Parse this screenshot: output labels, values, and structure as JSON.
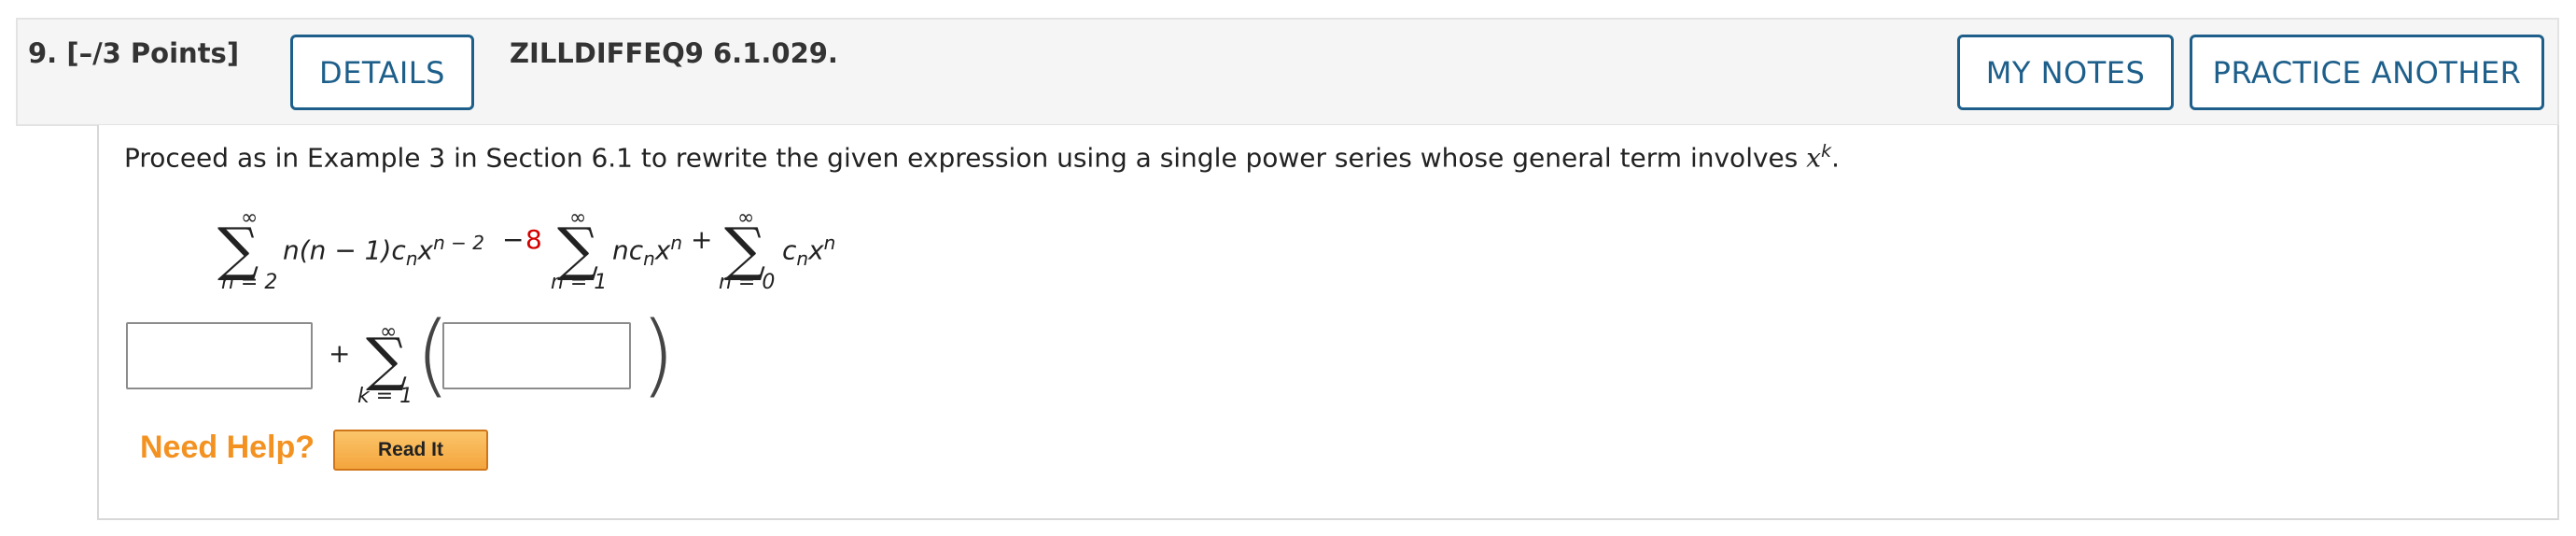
{
  "header": {
    "question_number": "9.",
    "points": "[–/3 Points]",
    "details_button": "DETAILS",
    "problem_code": "ZILLDIFFEQ9 6.1.029.",
    "my_notes_button": "MY NOTES",
    "practice_another_button": "PRACTICE ANOTHER"
  },
  "question": {
    "prompt": "Proceed as in Example 3 in Section 6.1 to rewrite the given expression using a single power series whose general term involves",
    "prompt_var": "x",
    "prompt_sup": "k",
    "prompt_end": ".",
    "expression": {
      "sum1": {
        "upper": "∞",
        "lower": "n = 2",
        "term": "n(n − 1)c",
        "sub": "n",
        "x": "x",
        "exp": "n − 2"
      },
      "op1": "−",
      "coef": "8",
      "sum2": {
        "upper": "∞",
        "lower": "n = 1",
        "term": "nc",
        "sub": "n",
        "x": "x",
        "exp": "n"
      },
      "op2": "+",
      "sum3": {
        "upper": "∞",
        "lower": "n = 0",
        "term": "c",
        "sub": "n",
        "x": "x",
        "exp": "n"
      }
    },
    "answer": {
      "plus": "+",
      "sum_upper": "∞",
      "sum_lower": "k = 1",
      "input1_value": "",
      "input2_value": ""
    }
  },
  "help": {
    "need_help": "Need Help?",
    "read_it_button": "Read It"
  },
  "colors": {
    "accent": "#1d5f8a",
    "highlight": "#d40000",
    "help": "#f39221"
  }
}
